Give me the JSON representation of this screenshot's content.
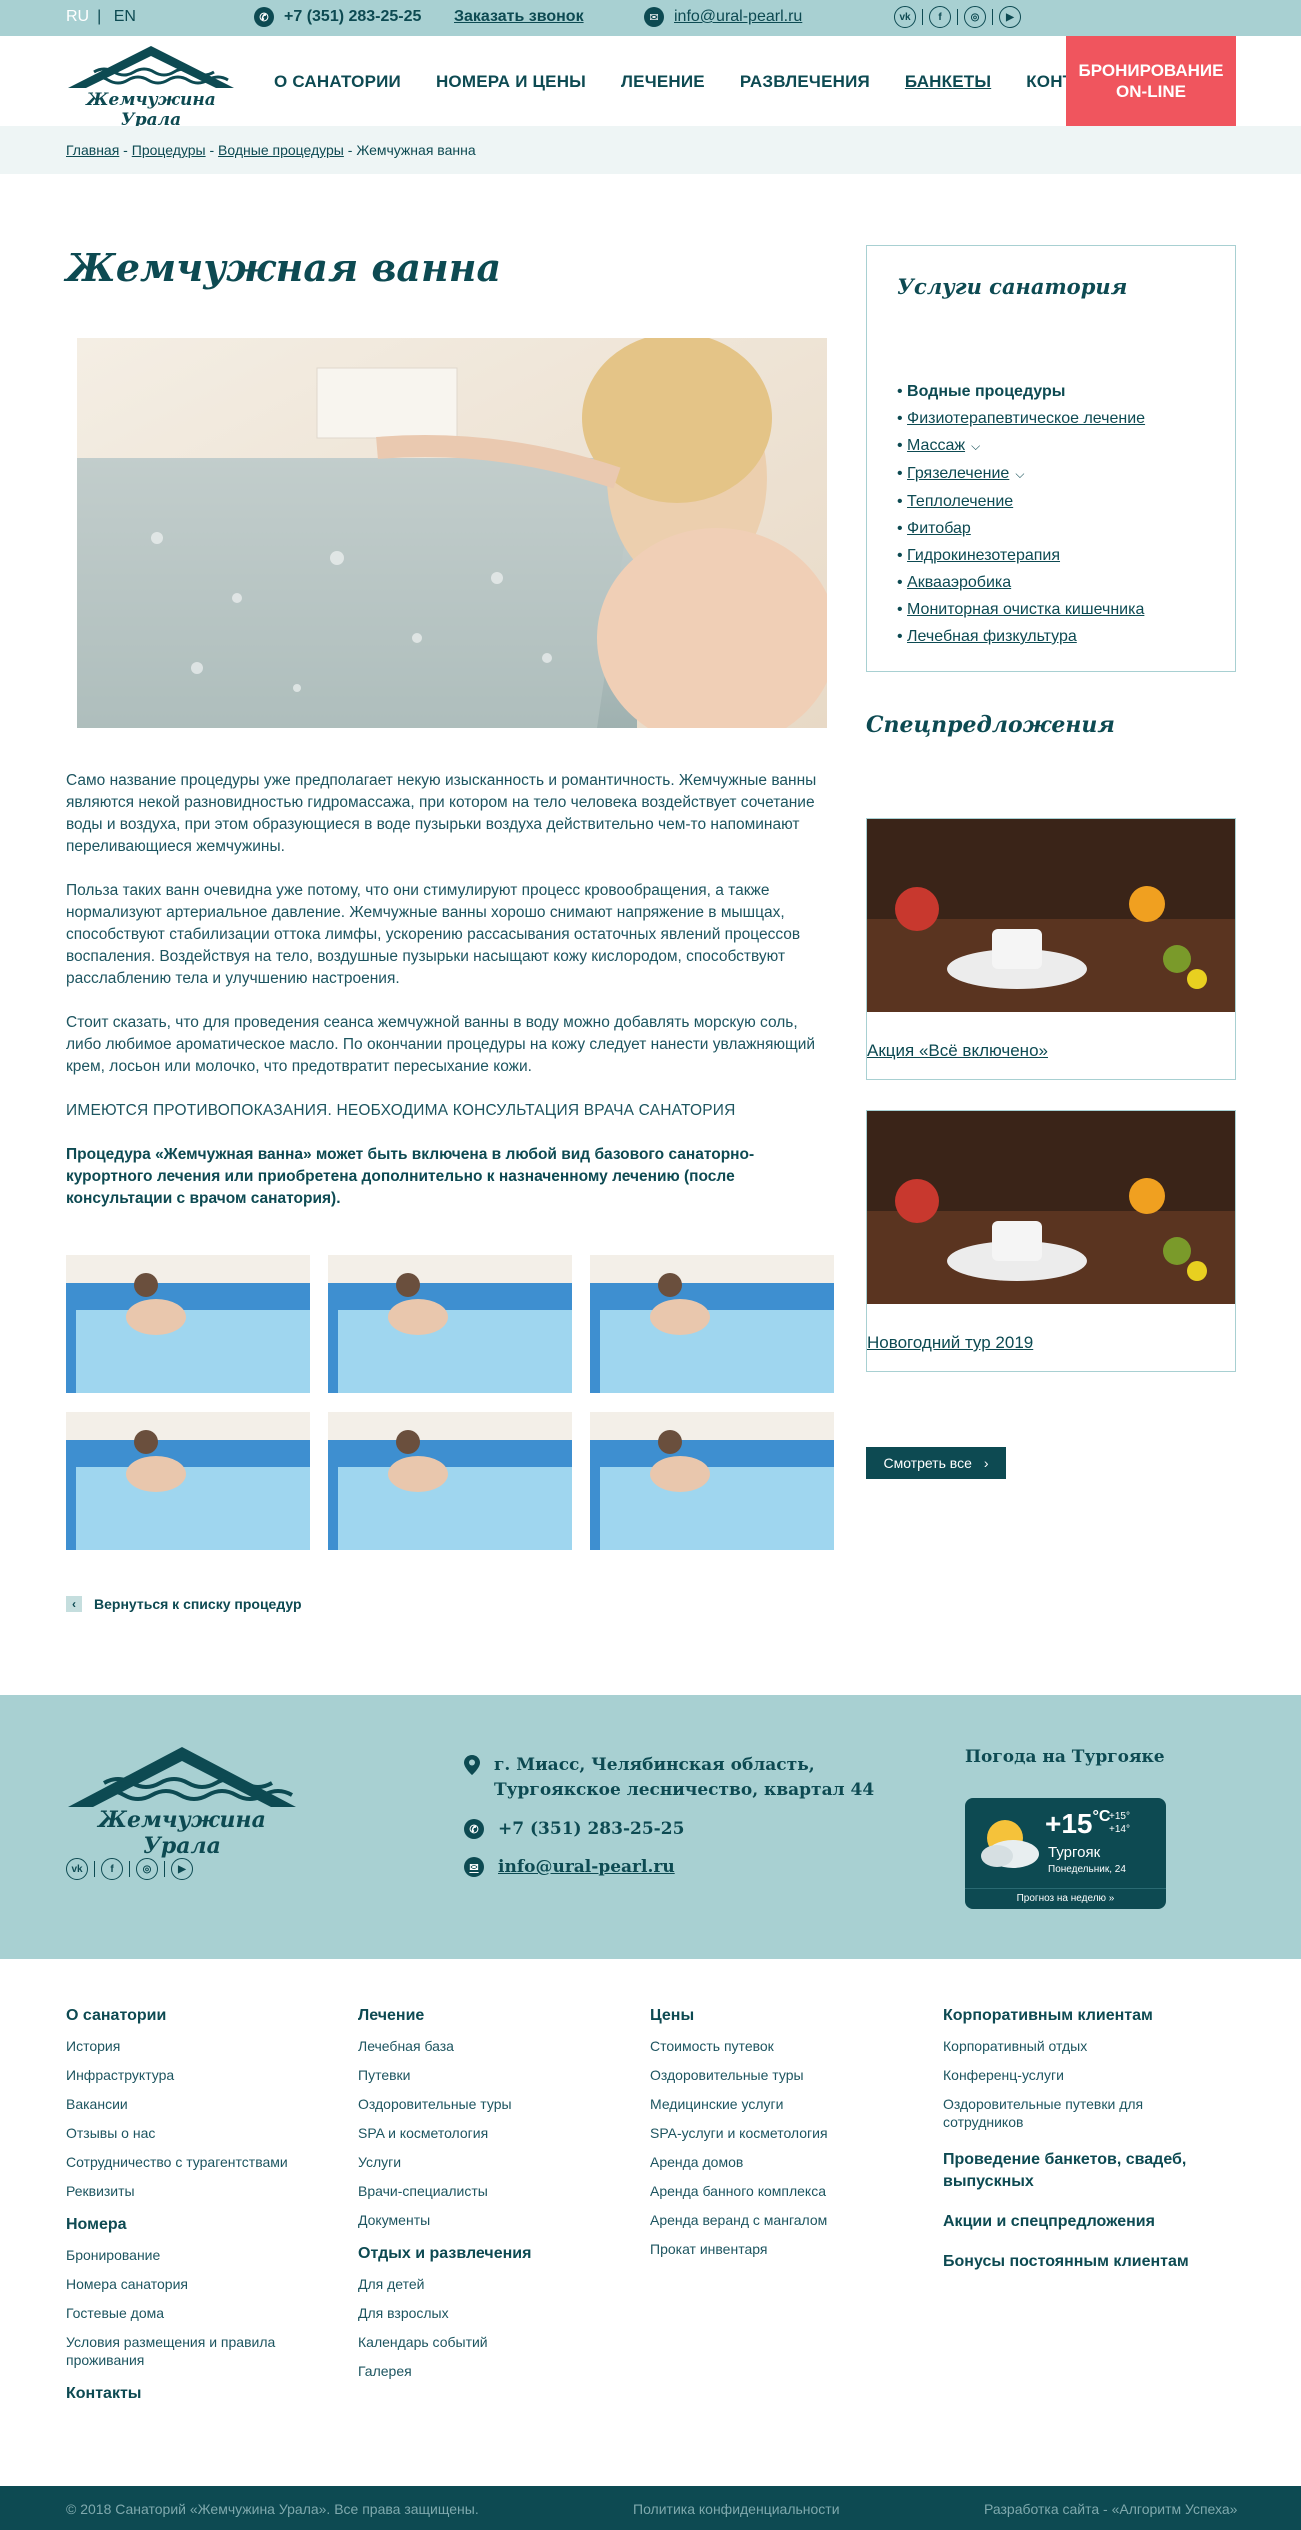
{
  "topbar": {
    "lang_ru": "RU",
    "lang_sep": "|",
    "lang_en": "EN",
    "phone": "+7 (351) 283-25-25",
    "call_link": "Заказать звонок",
    "email": "info@ural-pearl.ru",
    "socials": [
      "vk",
      "facebook",
      "instagram",
      "youtube"
    ]
  },
  "header": {
    "logo_text": "Жемчужина Урала",
    "nav": [
      "О САНАТОРИИ",
      "НОМЕРА И ЦЕНЫ",
      "ЛЕЧЕНИЕ",
      "РАЗВЛЕЧЕНИЯ",
      "БАНКЕТЫ",
      "КОНТАКТЫ"
    ],
    "booking_line1": "БРОНИРОВАНИЕ",
    "booking_line2": "ON-LINE"
  },
  "breadcrumb": {
    "items": [
      "Главная",
      "Процедуры",
      "Водные процедуры",
      "Жемчужная ванна"
    ],
    "sep": " - "
  },
  "page": {
    "title": "Жемчужная ванна",
    "paragraphs": [
      "Само название процедуры уже предполагает некую изысканность и романтичность. Жемчужные ванны являются некой разновидностью гидромассажа, при котором на тело человека воздействует сочетание воды и воздуха, при этом образующиеся в воде пузырьки воздуха действительно чем-то напоминают переливающиеся жемчужины.",
      "Польза таких ванн очевидна уже потому, что они стимулируют процесс кровообращения, а также нормализуют артериальное давление. Жемчужные ванны хорошо снимают напряжение в мышцах, способствуют стабилизации оттока лимфы, ускорению рассасывания остаточных явлений процессов воспаления. Воздействуя на тело, воздушные пузырьки насыщают кожу кислородом, способствуют расслаблению тела и улучшению настроения.",
      "Стоит сказать, что для проведения сеанса жемчужной ванны в воду можно добавлять морскую соль, либо любимое ароматическое масло. По окончании процедуры на кожу следует нанести увлажняющий крем, лосьон или молочко, что предотвратит пересыхание кожи."
    ],
    "warning": "ИМЕЮТСЯ ПРОТИВОПОКАЗАНИЯ. НЕОБХОДИМА КОНСУЛЬТАЦИЯ ВРАЧА САНАТОРИЯ",
    "note": "Процедура «Жемчужная ванна» может быть включена в любой вид базового санаторно-курортного лечения или приобретена дополнительно к назначенному лечению (после консультации с врачом санатория).",
    "back_link": "Вернуться к списку процедур"
  },
  "services": {
    "title": "Услуги санатория",
    "items": [
      {
        "label": "Водные процедуры",
        "active": true,
        "dropdown": false
      },
      {
        "label": "Физиотерапевтическое лечение",
        "active": false,
        "dropdown": false
      },
      {
        "label": "Массаж",
        "active": false,
        "dropdown": true
      },
      {
        "label": "Грязелечение",
        "active": false,
        "dropdown": true
      },
      {
        "label": "Теплолечение",
        "active": false,
        "dropdown": false
      },
      {
        "label": "Фитобар",
        "active": false,
        "dropdown": false
      },
      {
        "label": "Гидрокинезотерапия",
        "active": false,
        "dropdown": false
      },
      {
        "label": "Аквааэробика",
        "active": false,
        "dropdown": false
      },
      {
        "label": "Мониторная очистка кишечника",
        "active": false,
        "dropdown": false
      },
      {
        "label": "Лечебная физкультура",
        "active": false,
        "dropdown": false
      }
    ]
  },
  "offers": {
    "title": "Спецпредложения",
    "items": [
      "Акция «Всё включено»",
      "Новогодний тур 2019"
    ],
    "see_all": "Смотреть все"
  },
  "footer": {
    "logo_text": "Жемчужина Урала",
    "address_line1": "г. Миасс, Челябинская область,",
    "address_line2": "Тургоякское лесничество, квартал 44",
    "phone": "+7 (351) 283-25-25",
    "email": "info@ural-pearl.ru",
    "weather_title": "Погода на Тургояке",
    "weather": {
      "temp": "+15",
      "unit": "°C",
      "max": "+15°",
      "min": "+14°",
      "place": "Тургояк",
      "date": "Понедельник, 24",
      "week": "Прогноз на неделю »"
    },
    "columns": [
      {
        "sections": [
          {
            "title": "О санатории",
            "links": [
              "История",
              "Инфраструктура",
              "Вакансии",
              "Отзывы о нас",
              "Сотрудничество с турагентствами",
              "Реквизиты"
            ]
          },
          {
            "title": "Номера",
            "links": [
              "Бронирование",
              "Номера санатория",
              "Гостевые дома",
              "Условия размещения и правила проживания"
            ]
          },
          {
            "title": "Контакты",
            "links": []
          }
        ]
      },
      {
        "sections": [
          {
            "title": "Лечение",
            "links": [
              "Лечебная база",
              "Путевки",
              "Оздоровительные туры",
              "SPA и косметология",
              "Услуги",
              "Врачи-специалисты",
              "Документы"
            ]
          },
          {
            "title": "Отдых и развлечения",
            "links": [
              "Для детей",
              "Для взрослых",
              "Календарь событий",
              "Галерея"
            ]
          }
        ]
      },
      {
        "sections": [
          {
            "title": "Цены",
            "links": [
              "Стоимость путевок",
              "Оздоровительные туры",
              "Медицинские услуги",
              "SPA-услуги и косметология",
              "Аренда домов",
              "Аренда банного комплекса",
              "Аренда веранд с мангалом",
              "Прокат инвентаря"
            ]
          }
        ]
      },
      {
        "sections": [
          {
            "title": "Корпоративным клиентам",
            "links": [
              "Корпоративный отдых",
              "Конференц-услуги",
              "Оздоровительные путевки для сотрудников"
            ]
          },
          {
            "title": "Проведение банкетов, свадеб, выпускных",
            "links": []
          },
          {
            "title": "Акции и спецпредложения",
            "links": []
          },
          {
            "title": "Бонусы постоянным клиентам",
            "links": []
          }
        ]
      }
    ],
    "copyright": "© 2018 Санаторий «Жемчужина Урала». Все права защищены.",
    "privacy": "Политика конфиденциальности",
    "developer": "Разработка сайта - «Алгоритм Успеха»"
  },
  "colors": {
    "primary": "#0d4a52",
    "topbar": "#a8d0d2",
    "accent": "#f0555e",
    "breadcrumb_bg": "#eef5f5"
  }
}
